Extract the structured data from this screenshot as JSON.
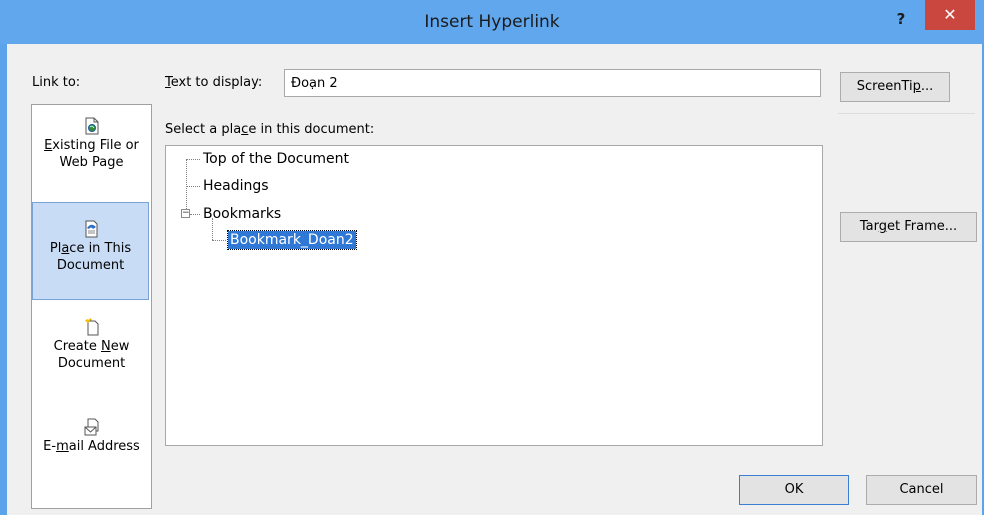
{
  "window": {
    "title": "Insert Hyperlink",
    "help_glyph": "?",
    "close_glyph": "✕"
  },
  "link_to": {
    "label": "Link to:",
    "items": [
      {
        "pre": "",
        "key": "E",
        "post": "xisting File or Web Page",
        "icon": "existing-file-icon"
      },
      {
        "pre": "Pl",
        "key": "a",
        "post": "ce in This Document",
        "icon": "place-in-document-icon",
        "selected": true
      },
      {
        "pre": "Create ",
        "key": "N",
        "post": "ew Document",
        "icon": "new-document-icon"
      },
      {
        "pre": "E-",
        "key": "m",
        "post": "ail Address",
        "icon": "email-address-icon"
      }
    ]
  },
  "text_to_display": {
    "label_key": "T",
    "label_rest": "ext to display:",
    "value": "Đoạn 2"
  },
  "buttons": {
    "screentip_pre": "ScreenTi",
    "screentip_key": "p",
    "screentip_post": "...",
    "target_pre": "Tar",
    "target_key": "g",
    "target_post": "et Frame...",
    "ok": "OK",
    "cancel": "Cancel"
  },
  "select_place": {
    "label_pre": "Select a pla",
    "label_key": "c",
    "label_post": "e in this document:",
    "tree": {
      "top": "Top of the Document",
      "headings": "Headings",
      "bookmarks": "Bookmarks",
      "bookmarks_expander": "−",
      "bookmark_child": "Bookmark_Doan2"
    }
  },
  "colors": {
    "titlebar": "#60a7ee",
    "close_button": "#c9473e",
    "selection": "#2f78d6"
  }
}
